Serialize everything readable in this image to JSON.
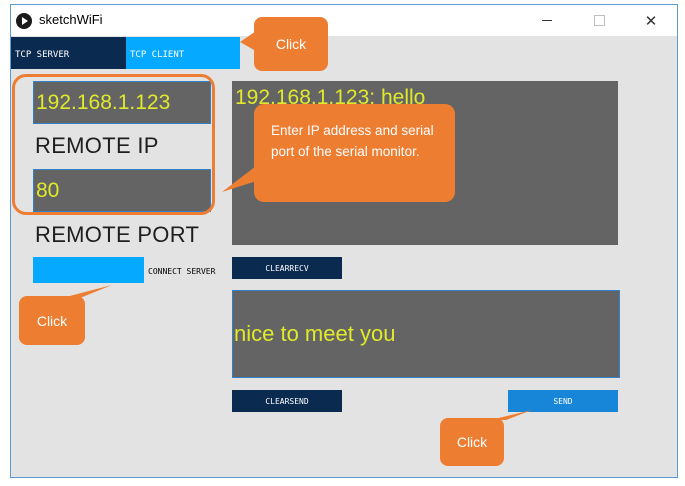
{
  "window": {
    "title": "sketchWiFi",
    "controls": {
      "minimize": "minimize-icon",
      "maximize": "maximize-icon",
      "close": "close-icon"
    }
  },
  "tabs": [
    {
      "label": "TCP SERVER",
      "active": false
    },
    {
      "label": "TCP CLIENT",
      "active": true
    }
  ],
  "client": {
    "remote_ip_value": "192.168.1.123",
    "remote_ip_label": "REMOTE IP",
    "remote_port_value": "80",
    "remote_port_label": "REMOTE PORT",
    "connect_label": "CONNECT SERVER"
  },
  "receive": {
    "text": "192.168.1.123:  hello",
    "clear_label": "CLEARRECV"
  },
  "send": {
    "text": "nice to meet you",
    "clear_label": "CLEARSEND",
    "send_label": "SEND"
  },
  "annotations": {
    "click_tab": "Click",
    "info": "Enter IP address and serial port of the serial monitor.",
    "click_connect": "Click",
    "click_send": "Click"
  },
  "colors": {
    "accent_blue": "#05a9ff",
    "navy": "#0a2a50",
    "field_bg": "#646464",
    "field_text": "#e0ea2a",
    "callout": "#ed7d31"
  }
}
